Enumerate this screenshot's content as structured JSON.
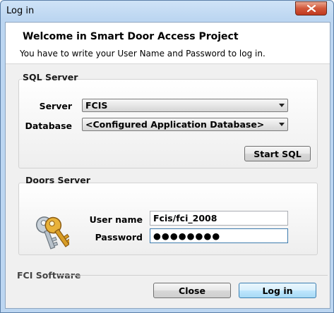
{
  "window": {
    "title": "Log in"
  },
  "header": {
    "title": "Welcome in Smart Door Access Project",
    "subtitle": "You have to write your User Name and Password to log in."
  },
  "sql_server": {
    "group_label": "SQL Server",
    "server_label": "Server",
    "server_value": "FCIS",
    "database_label": "Database",
    "database_value": "<Configured Application Database>",
    "start_button": "Start SQL"
  },
  "doors_server": {
    "group_label": "Doors Server",
    "username_label": "User name",
    "username_value": "Fcis/fci_2008",
    "password_label": "Password",
    "password_value": "●●●●●●●●"
  },
  "footer": {
    "label": "FCI Software",
    "close_button": "Close",
    "login_button": "Log in"
  },
  "icons": {
    "close": "close-icon",
    "keys": "keys-icon"
  },
  "colors": {
    "titlebar": "#bcd6f1",
    "close_red": "#c0391f",
    "primary_button": "#bee6fd"
  }
}
